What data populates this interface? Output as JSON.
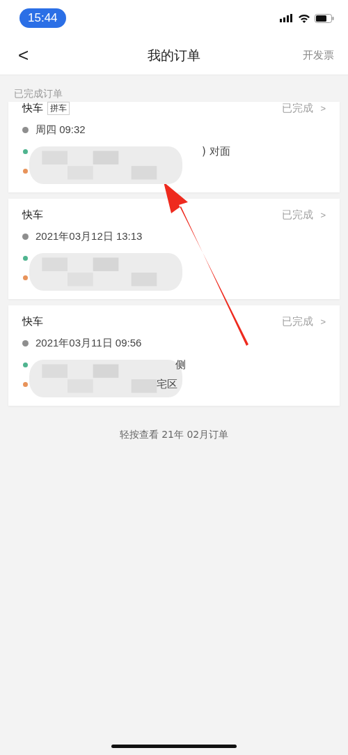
{
  "status_bar": {
    "time": "15:44"
  },
  "nav": {
    "back": "<",
    "title": "我的订单",
    "action": "开发票"
  },
  "section": {
    "label": "已完成订单"
  },
  "orders": [
    {
      "type": "快车",
      "tag": "拼车",
      "status": "已完成",
      "chevron": ">",
      "time": "周四 09:32",
      "clipped": true,
      "routes": [
        {
          "kind": "start",
          "text": ") 对面"
        },
        {
          "kind": "end"
        }
      ]
    },
    {
      "type": "快车",
      "status": "已完成",
      "chevron": ">",
      "time": "2021年03月12日 13:13",
      "clipped": false,
      "routes": [
        {
          "kind": "start"
        },
        {
          "kind": "end"
        }
      ]
    },
    {
      "type": "快车",
      "status": "已完成",
      "chevron": ">",
      "time": "2021年03月11日 09:56",
      "clipped": false,
      "routes": [
        {
          "kind": "start",
          "text": "侧"
        },
        {
          "kind": "end",
          "text": "宅区"
        }
      ]
    }
  ],
  "footer": {
    "link": "轻按查看 21年 02月订单"
  }
}
